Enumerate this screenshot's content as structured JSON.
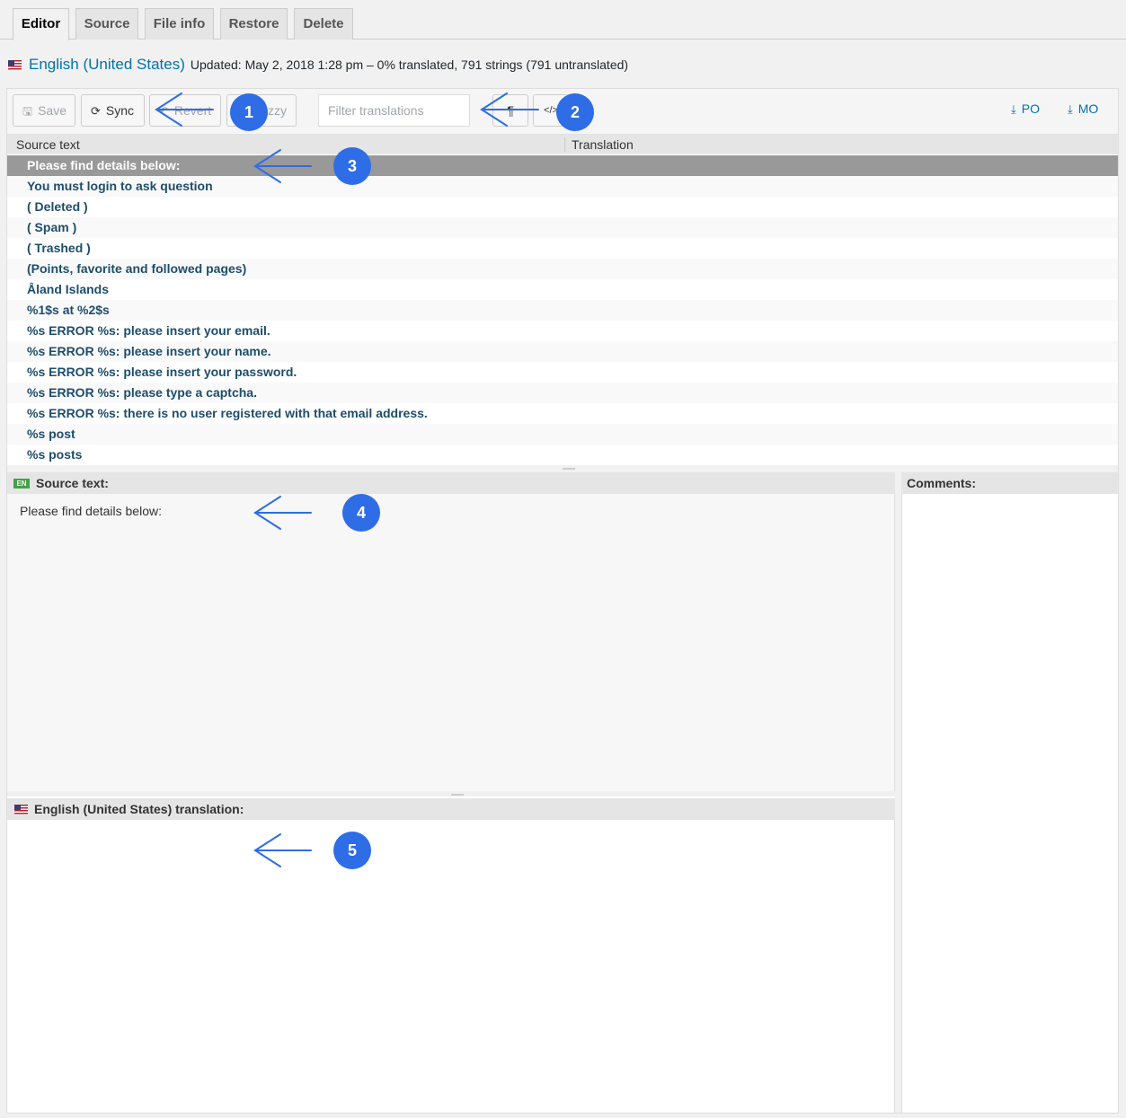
{
  "tabs": [
    "Editor",
    "Source",
    "File info",
    "Restore",
    "Delete"
  ],
  "header": {
    "title": "English (United States)",
    "status": "Updated: May 2, 2018 1:28 pm – 0% translated, 791 strings (791 untranslated)"
  },
  "toolbar": {
    "save": "Save",
    "sync": "Sync",
    "revert": "Revert",
    "fuzzy": "zzy",
    "filter_placeholder": "Filter translations",
    "pilcrow": "¶",
    "code": "</>",
    "po": "PO",
    "mo": "MO"
  },
  "grid": {
    "col_source": "Source text",
    "col_translation": "Translation",
    "rows": [
      "Please find details below:",
      "You must login to ask question",
      "( Deleted )",
      "( Spam )",
      "( Trashed )",
      "(Points, favorite and followed pages)",
      "Åland Islands",
      "%1$s at %2$s",
      "%s ERROR %s: please insert your email.",
      "%s ERROR %s: please insert your name.",
      "%s ERROR %s: please insert your password.",
      "%s ERROR %s: please type a captcha.",
      "%s ERROR %s: there is no user registered with that email address.",
      "%s post",
      "%s posts"
    ]
  },
  "source_panel": {
    "badge": "EN",
    "heading": "Source text:",
    "text": "Please find details below:"
  },
  "translation_panel": {
    "heading": "English (United States) translation:"
  },
  "comments_panel": {
    "heading": "Comments:"
  },
  "annotations": [
    "1",
    "2",
    "3",
    "4",
    "5"
  ],
  "colors": {
    "accent": "#0073aa",
    "annotation": "#2e6de6",
    "selected_row": "#999999"
  }
}
